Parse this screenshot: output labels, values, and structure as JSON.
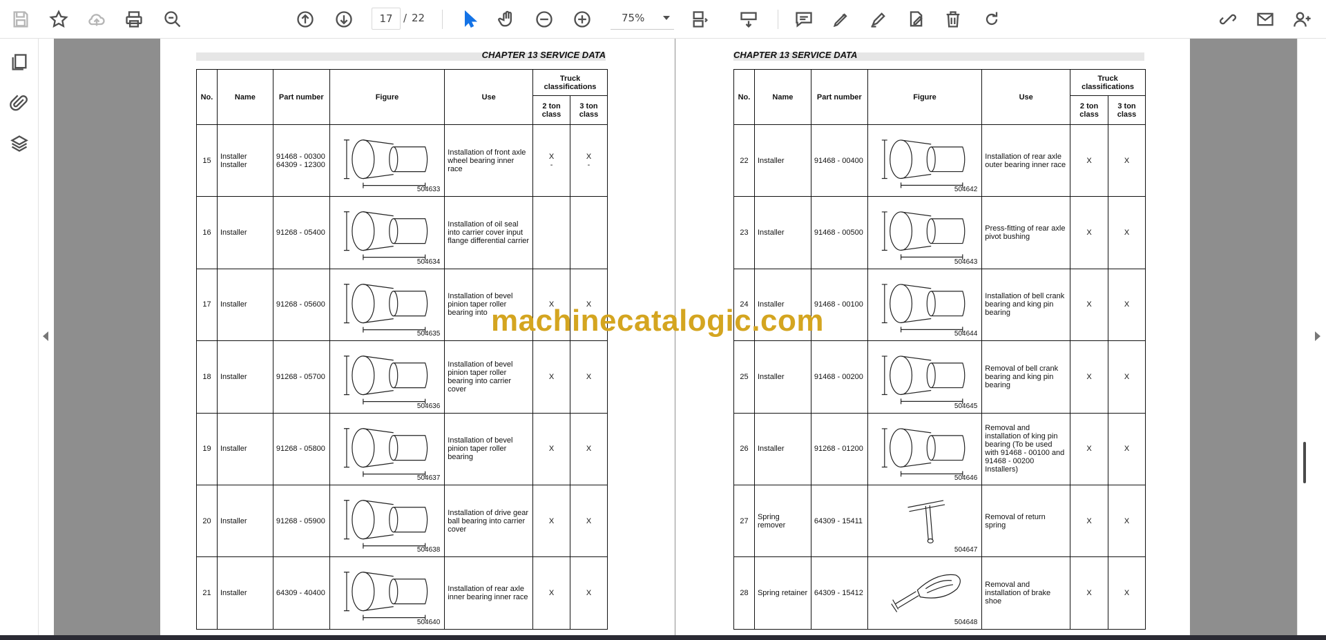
{
  "toolbar": {
    "current_page": "17",
    "page_separator": "/",
    "total_pages": "22",
    "zoom_level": "75%"
  },
  "document": {
    "chapter_title": "CHAPTER 13 SERVICE DATA",
    "headers": {
      "no": "No.",
      "name": "Name",
      "part_number": "Part number",
      "figure": "Figure",
      "use": "Use",
      "truck_classifications": "Truck classifications",
      "two_ton": "2 ton class",
      "three_ton": "3 ton class"
    },
    "left_rows": [
      {
        "no": "15",
        "name": "Installer\nInstaller",
        "part": "91468 - 00300\n64309 - 12300",
        "fig": "504633",
        "use": "Installation of front axle wheel bearing inner race",
        "c2": "X\n-",
        "c3": "X\n-"
      },
      {
        "no": "16",
        "name": "Installer",
        "part": "91268 - 05400",
        "fig": "504634",
        "use": "Installation of oil seal into carrier cover input flange differential carrier",
        "c2": "",
        "c3": ""
      },
      {
        "no": "17",
        "name": "Installer",
        "part": "91268 - 05600",
        "fig": "504635",
        "use": "Installation of bevel pinion taper roller bearing into",
        "c2": "X",
        "c3": "X"
      },
      {
        "no": "18",
        "name": "Installer",
        "part": "91268 - 05700",
        "fig": "504636",
        "use": "Installation of bevel pinion taper roller bearing into carrier cover",
        "c2": "X",
        "c3": "X"
      },
      {
        "no": "19",
        "name": "Installer",
        "part": "91268 - 05800",
        "fig": "504637",
        "use": "Installation of bevel pinion taper roller bearing",
        "c2": "X",
        "c3": "X"
      },
      {
        "no": "20",
        "name": "Installer",
        "part": "91268 - 05900",
        "fig": "504638",
        "use": "Installation of drive gear ball bearing into carrier cover",
        "c2": "X",
        "c3": "X"
      },
      {
        "no": "21",
        "name": "Installer",
        "part": "64309 - 40400",
        "fig": "504640",
        "use": "Installation of rear axle inner bearing inner race",
        "c2": "X",
        "c3": "X"
      }
    ],
    "right_rows": [
      {
        "no": "22",
        "name": "Installer",
        "part": "91468 - 00400",
        "fig": "504642",
        "use": "Installation of rear axle outer bearing inner race",
        "c2": "X",
        "c3": "X"
      },
      {
        "no": "23",
        "name": "Installer",
        "part": "91468 - 00500",
        "fig": "504643",
        "use": "Press-fitting of rear axle pivot bushing",
        "c2": "X",
        "c3": "X"
      },
      {
        "no": "24",
        "name": "Installer",
        "part": "91468 - 00100",
        "fig": "504644",
        "use": "Installation of bell crank bearing and king pin bearing",
        "c2": "X",
        "c3": "X"
      },
      {
        "no": "25",
        "name": "Installer",
        "part": "91468 - 00200",
        "fig": "504645",
        "use": "Removal of bell crank bearing and king pin bearing",
        "c2": "X",
        "c3": "X"
      },
      {
        "no": "26",
        "name": "Installer",
        "part": "91268 - 01200",
        "fig": "504646",
        "use": "Removal and installation of king pin bearing (To be used with 91468 - 00100 and 91468 - 00200 Installers)",
        "c2": "X",
        "c3": "X"
      },
      {
        "no": "27",
        "name": "Spring remover",
        "part": "64309 - 15411",
        "fig": "504647",
        "use": "Removal of return spring",
        "c2": "X",
        "c3": "X"
      },
      {
        "no": "28",
        "name": "Spring retainer",
        "part": "64309 - 15412",
        "fig": "504648",
        "use": "Removal and installation of brake shoe",
        "c2": "X",
        "c3": "X"
      }
    ],
    "figure_icons": [
      "installer-drawing",
      "installer-drawing",
      "installer-drawing",
      "installer-drawing",
      "installer-drawing",
      "installer-drawing",
      "installer-drawing",
      "installer-drawing",
      "installer-drawing",
      "installer-drawing",
      "installer-drawing",
      "installer-drawing",
      "t-handle-tool-drawing",
      "spring-retainer-drawing"
    ]
  },
  "watermark": "machinecatalogic.com",
  "colors": {
    "accent": "#1473e6",
    "viewport_bg": "#8e8e8e",
    "watermark": "#d4a520"
  }
}
